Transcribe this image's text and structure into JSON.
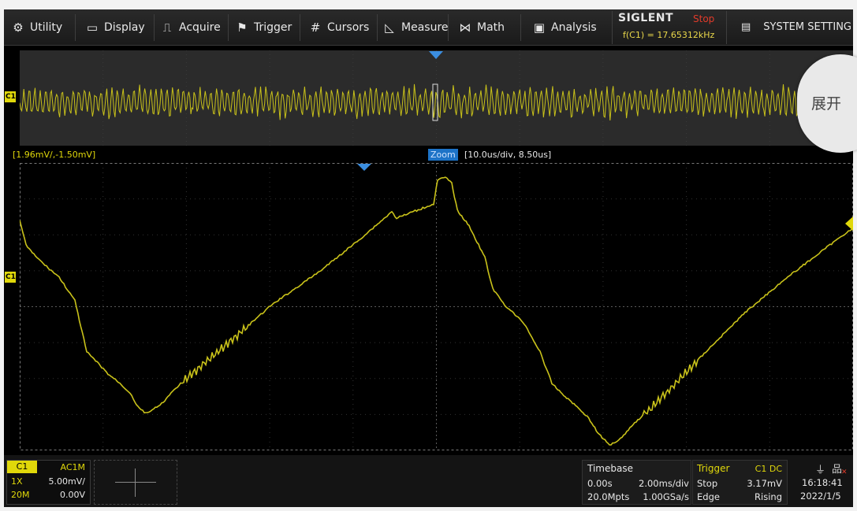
{
  "menu": {
    "items": [
      {
        "label": "Utility",
        "icon": "gear-icon",
        "glyph": "⚙"
      },
      {
        "label": "Display",
        "icon": "monitor-icon",
        "glyph": "▭"
      },
      {
        "label": "Acquire",
        "icon": "acquire-icon",
        "glyph": "⎍"
      },
      {
        "label": "Trigger",
        "icon": "flag-icon",
        "glyph": "⚑"
      },
      {
        "label": "Cursors",
        "icon": "cursors-icon",
        "glyph": "#"
      },
      {
        "label": "Measure",
        "icon": "measure-icon",
        "glyph": "◺"
      },
      {
        "label": "Math",
        "icon": "math-icon",
        "glyph": "⋈"
      },
      {
        "label": "Analysis",
        "icon": "analysis-icon",
        "glyph": "▣"
      }
    ],
    "brand": "SIGLENT",
    "run_state": "Stop",
    "frequency": "f(C1) = 17.65312kHz",
    "system_setting": "SYSTEM SETTING"
  },
  "overview": {
    "channel": "C1"
  },
  "zoom": {
    "range": "[1.96mV/,-1.50mV]",
    "tag": "Zoom",
    "info": "[10.0us/div, 8.50us]",
    "channel": "C1"
  },
  "channel_info": {
    "name": "C1",
    "coupling": "AC1M",
    "probe": "1X",
    "scale": "5.00mV/",
    "bandwidth": "20M",
    "offset": "0.00V"
  },
  "timebase": {
    "title": "Timebase",
    "delay": "0.00s",
    "scale": "2.00ms/div",
    "memory": "20.0Mpts",
    "sample_rate": "1.00GSa/s"
  },
  "trigger": {
    "title": "Trigger",
    "source": "C1 DC",
    "state": "Stop",
    "level": "3.17mV",
    "type": "Edge",
    "slope": "Rising"
  },
  "clock": {
    "time": "16:18:41",
    "date": "2022/1/5"
  },
  "overlay": {
    "expand_label": "展开"
  },
  "colors": {
    "trace": "#c9c21a",
    "channel": "#e0d80a",
    "stop": "#e23b2a",
    "zoom_blue": "#1d73c7"
  }
}
